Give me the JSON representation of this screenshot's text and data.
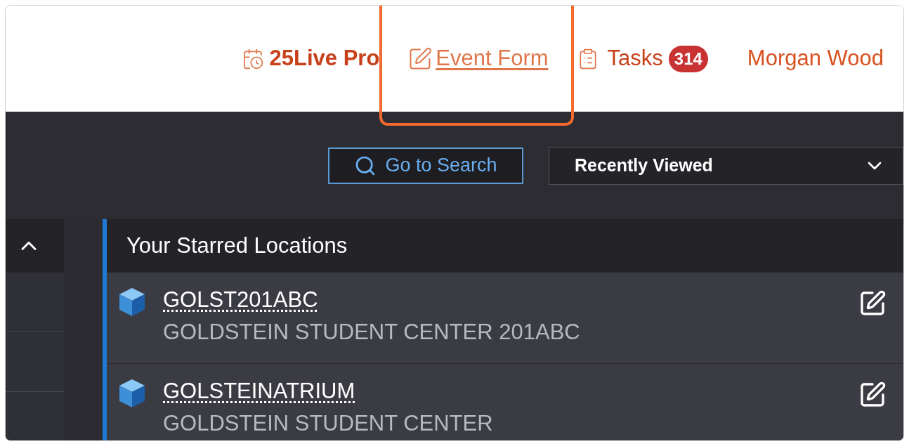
{
  "header": {
    "nav": [
      {
        "kind": "app",
        "label": "25Live Pro"
      },
      {
        "kind": "link",
        "label": "Event Form"
      },
      {
        "kind": "tasks",
        "label": "Tasks",
        "badge": "314"
      },
      {
        "kind": "user",
        "label": "Morgan Wood"
      }
    ]
  },
  "toolbar": {
    "search_button": "Go to Search",
    "dropdown": {
      "value": "Recently Viewed"
    }
  },
  "starred_panel": {
    "title": "Your Starred Locations",
    "items": [
      {
        "code": "GOLST201ABC",
        "name": "GOLDSTEIN STUDENT CENTER 201ABC"
      },
      {
        "code": "GOLSTEINATRIUM",
        "name": "GOLDSTEIN STUDENT CENTER"
      }
    ]
  }
}
